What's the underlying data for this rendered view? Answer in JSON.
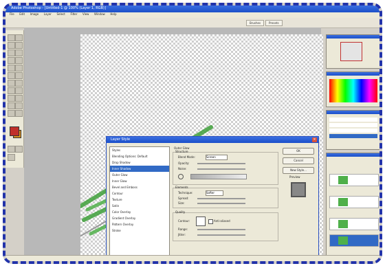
{
  "window": {
    "title": "Adobe Photoshop - [Untitled-1 @ 100% (Layer 1, RGB)]",
    "menus": [
      "File",
      "Edit",
      "Image",
      "Layer",
      "Select",
      "Filter",
      "View",
      "Window",
      "Help"
    ],
    "option_tabs": [
      "Brushes",
      "Presets"
    ]
  },
  "dialog": {
    "title": "Layer Style",
    "styles": [
      "Styles",
      "Blending Options: Default",
      "Drop Shadow",
      "Inner Shadow",
      "Outer Glow",
      "Inner Glow",
      "Bevel and Emboss",
      "Contour",
      "Texture",
      "Satin",
      "Color Overlay",
      "Gradient Overlay",
      "Pattern Overlay",
      "Stroke"
    ],
    "selected_index": 3,
    "buttons": [
      "OK",
      "Cancel",
      "New Style...",
      "Preview"
    ],
    "sections": {
      "outer_glow": "Outer Glow",
      "structure": "Structure",
      "elements": "Elements",
      "quality": "Quality",
      "blend_mode_label": "Blend Mode:",
      "blend_mode_value": "Screen",
      "opacity_label": "Opacity:",
      "noise_label": "Noise:",
      "technique_label": "Technique:",
      "technique_value": "Softer",
      "spread_label": "Spread:",
      "size_label": "Size:",
      "contour_label": "Contour:",
      "antialiased_label": "Anti-aliased",
      "range_label": "Range:",
      "jitter_label": "Jitter:"
    }
  },
  "colors": {
    "titlebar": "#1b4fc9",
    "selection": "#316ac5",
    "stroke_green": "#3fa03a",
    "frame_border": "#2233aa"
  }
}
